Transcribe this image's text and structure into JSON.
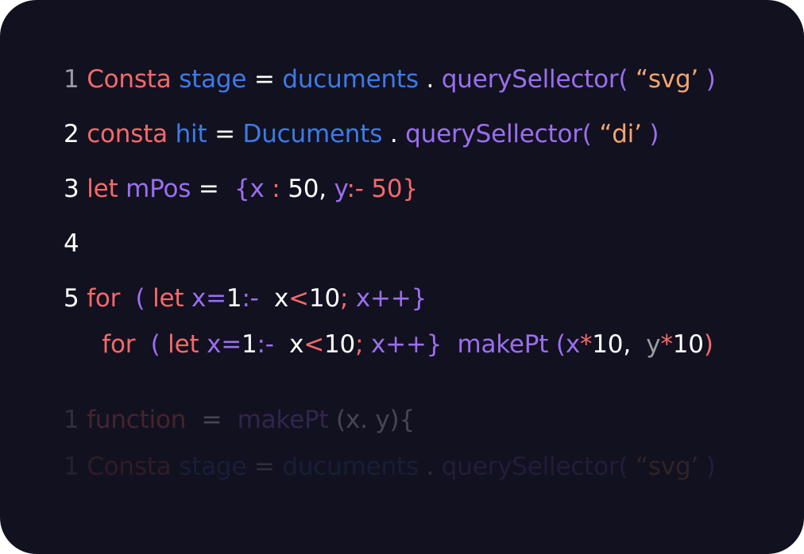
{
  "editor": {
    "background": "#12111f",
    "colors": {
      "red": "#f46a6a",
      "blue": "#3d7be8",
      "purple": "#9a6ff0",
      "orange": "#f2a66e",
      "white": "#ffffff",
      "gray": "#9b9ba5"
    },
    "lines": [
      {
        "id": "line-1",
        "tokens": [
          {
            "t": "1 ",
            "c": "gray"
          },
          {
            "t": "Consta",
            "c": "red"
          },
          {
            "t": " ",
            "c": "white"
          },
          {
            "t": "stage",
            "c": "blue"
          },
          {
            "t": " = ",
            "c": "white"
          },
          {
            "t": "ducuments",
            "c": "blue"
          },
          {
            "t": " . ",
            "c": "white"
          },
          {
            "t": "querySellector(",
            "c": "purple"
          },
          {
            "t": " “svg’",
            "c": "orange"
          },
          {
            "t": " )",
            "c": "purple"
          }
        ]
      },
      {
        "id": "line-2",
        "tokens": [
          {
            "t": "2 ",
            "c": "white"
          },
          {
            "t": "consta",
            "c": "red"
          },
          {
            "t": " ",
            "c": "white"
          },
          {
            "t": "hit",
            "c": "blue"
          },
          {
            "t": " = ",
            "c": "white"
          },
          {
            "t": "Ducuments",
            "c": "blue"
          },
          {
            "t": " . ",
            "c": "white"
          },
          {
            "t": "querySellector(",
            "c": "purple"
          },
          {
            "t": " “di’",
            "c": "orange"
          },
          {
            "t": " )",
            "c": "purple"
          }
        ]
      },
      {
        "id": "line-3",
        "tokens": [
          {
            "t": "3 ",
            "c": "white"
          },
          {
            "t": "let",
            "c": "red"
          },
          {
            "t": " mPos",
            "c": "purple"
          },
          {
            "t": " =  ",
            "c": "white"
          },
          {
            "t": "{x",
            "c": "purple"
          },
          {
            "t": " : ",
            "c": "red"
          },
          {
            "t": "50,",
            "c": "white"
          },
          {
            "t": " y",
            "c": "purple"
          },
          {
            "t": ":-",
            "c": "red"
          },
          {
            "t": " 50}",
            "c": "red"
          }
        ]
      },
      {
        "id": "line-4",
        "tokens": [
          {
            "t": "4",
            "c": "white"
          }
        ]
      },
      {
        "id": "line-5",
        "tokens": [
          {
            "t": "5 ",
            "c": "white"
          },
          {
            "t": "for",
            "c": "red"
          },
          {
            "t": "  ( ",
            "c": "purple"
          },
          {
            "t": "let",
            "c": "red"
          },
          {
            "t": " x=",
            "c": "purple"
          },
          {
            "t": "1",
            "c": "white"
          },
          {
            "t": ":-",
            "c": "purple"
          },
          {
            "t": "  x",
            "c": "white"
          },
          {
            "t": "<",
            "c": "red"
          },
          {
            "t": "10",
            "c": "white"
          },
          {
            "t": ";",
            "c": "red"
          },
          {
            "t": " x++}",
            "c": "purple"
          }
        ]
      },
      {
        "id": "line-6",
        "tokens": [
          {
            "t": "     ",
            "c": "white"
          },
          {
            "t": "for",
            "c": "red"
          },
          {
            "t": "  ( ",
            "c": "purple"
          },
          {
            "t": "let",
            "c": "red"
          },
          {
            "t": " x=",
            "c": "purple"
          },
          {
            "t": "1",
            "c": "white"
          },
          {
            "t": ":-",
            "c": "purple"
          },
          {
            "t": "  x",
            "c": "white"
          },
          {
            "t": "<",
            "c": "red"
          },
          {
            "t": "10",
            "c": "white"
          },
          {
            "t": ";",
            "c": "red"
          },
          {
            "t": " x++}",
            "c": "purple"
          },
          {
            "t": "  makePt",
            "c": "purple"
          },
          {
            "t": " (x",
            "c": "purple"
          },
          {
            "t": "*",
            "c": "red"
          },
          {
            "t": "10,",
            "c": "white"
          },
          {
            "t": "  y",
            "c": "gray"
          },
          {
            "t": "*",
            "c": "red"
          },
          {
            "t": "10",
            "c": "white"
          },
          {
            "t": ")",
            "c": "red"
          }
        ]
      },
      {
        "id": "line-7",
        "tokens": [
          {
            "t": "1 ",
            "c": "gray"
          },
          {
            "t": "function",
            "c": "red"
          },
          {
            "t": "  =  ",
            "c": "white"
          },
          {
            "t": "makePt",
            "c": "purple"
          },
          {
            "t": " (x. y){",
            "c": "white"
          }
        ]
      },
      {
        "id": "line-8",
        "tokens": [
          {
            "t": "1 ",
            "c": "gray"
          },
          {
            "t": "Consta",
            "c": "red"
          },
          {
            "t": " ",
            "c": "white"
          },
          {
            "t": "stage",
            "c": "blue"
          },
          {
            "t": " = ",
            "c": "white"
          },
          {
            "t": "ducuments",
            "c": "blue"
          },
          {
            "t": " . ",
            "c": "white"
          },
          {
            "t": "querySellector(",
            "c": "purple"
          },
          {
            "t": " “svg’",
            "c": "orange"
          },
          {
            "t": " )",
            "c": "purple"
          }
        ]
      }
    ]
  }
}
